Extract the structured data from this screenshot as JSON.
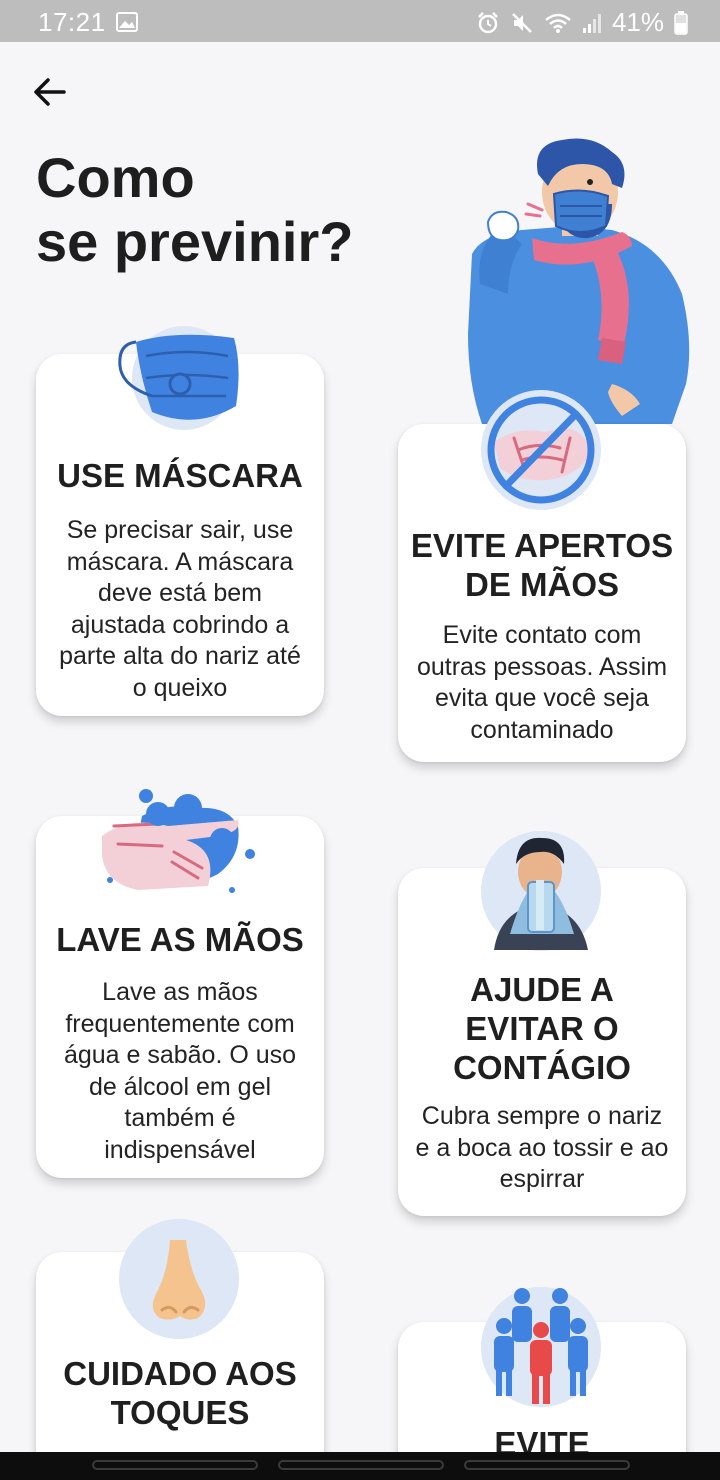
{
  "status_bar": {
    "time": "17:21",
    "battery": "41%"
  },
  "page": {
    "title_line1": "Como",
    "title_line2": "se previnir?"
  },
  "cards": [
    {
      "title": "USE MÁSCARA",
      "description": "Se precisar sair, use máscara. A máscara deve está bem ajustada cobrindo a parte alta do nariz até o queixo",
      "icon": "face-mask-icon"
    },
    {
      "title_line1": "EVITE APERTOS",
      "title_line2": "DE MÃOS",
      "description": "Evite contato com outras pessoas. Assim evita que você seja contaminado",
      "icon": "no-handshake-icon"
    },
    {
      "title": "LAVE AS MÃOS",
      "description": "Lave as mãos frequentemente com água e sabão. O uso de álcool em gel também é indispensável",
      "icon": "hand-washing-icon"
    },
    {
      "title_line1": "AJUDE A",
      "title_line2": "EVITAR O",
      "title_line3": "CONTÁGIO",
      "description": "Cubra sempre o nariz e a boca ao tossir e ao espirrar",
      "icon": "cover-sneeze-icon"
    },
    {
      "title_line1": "CUIDADO AOS",
      "title_line2": "TOQUES",
      "icon": "nose-icon"
    },
    {
      "title": "EVITE",
      "icon": "crowd-icon"
    }
  ],
  "colors": {
    "background": "#f6f6f8",
    "accent_blue": "#4a8fe0",
    "scarf_pink": "#e8708f",
    "icon_circle": "#dde7f5"
  }
}
